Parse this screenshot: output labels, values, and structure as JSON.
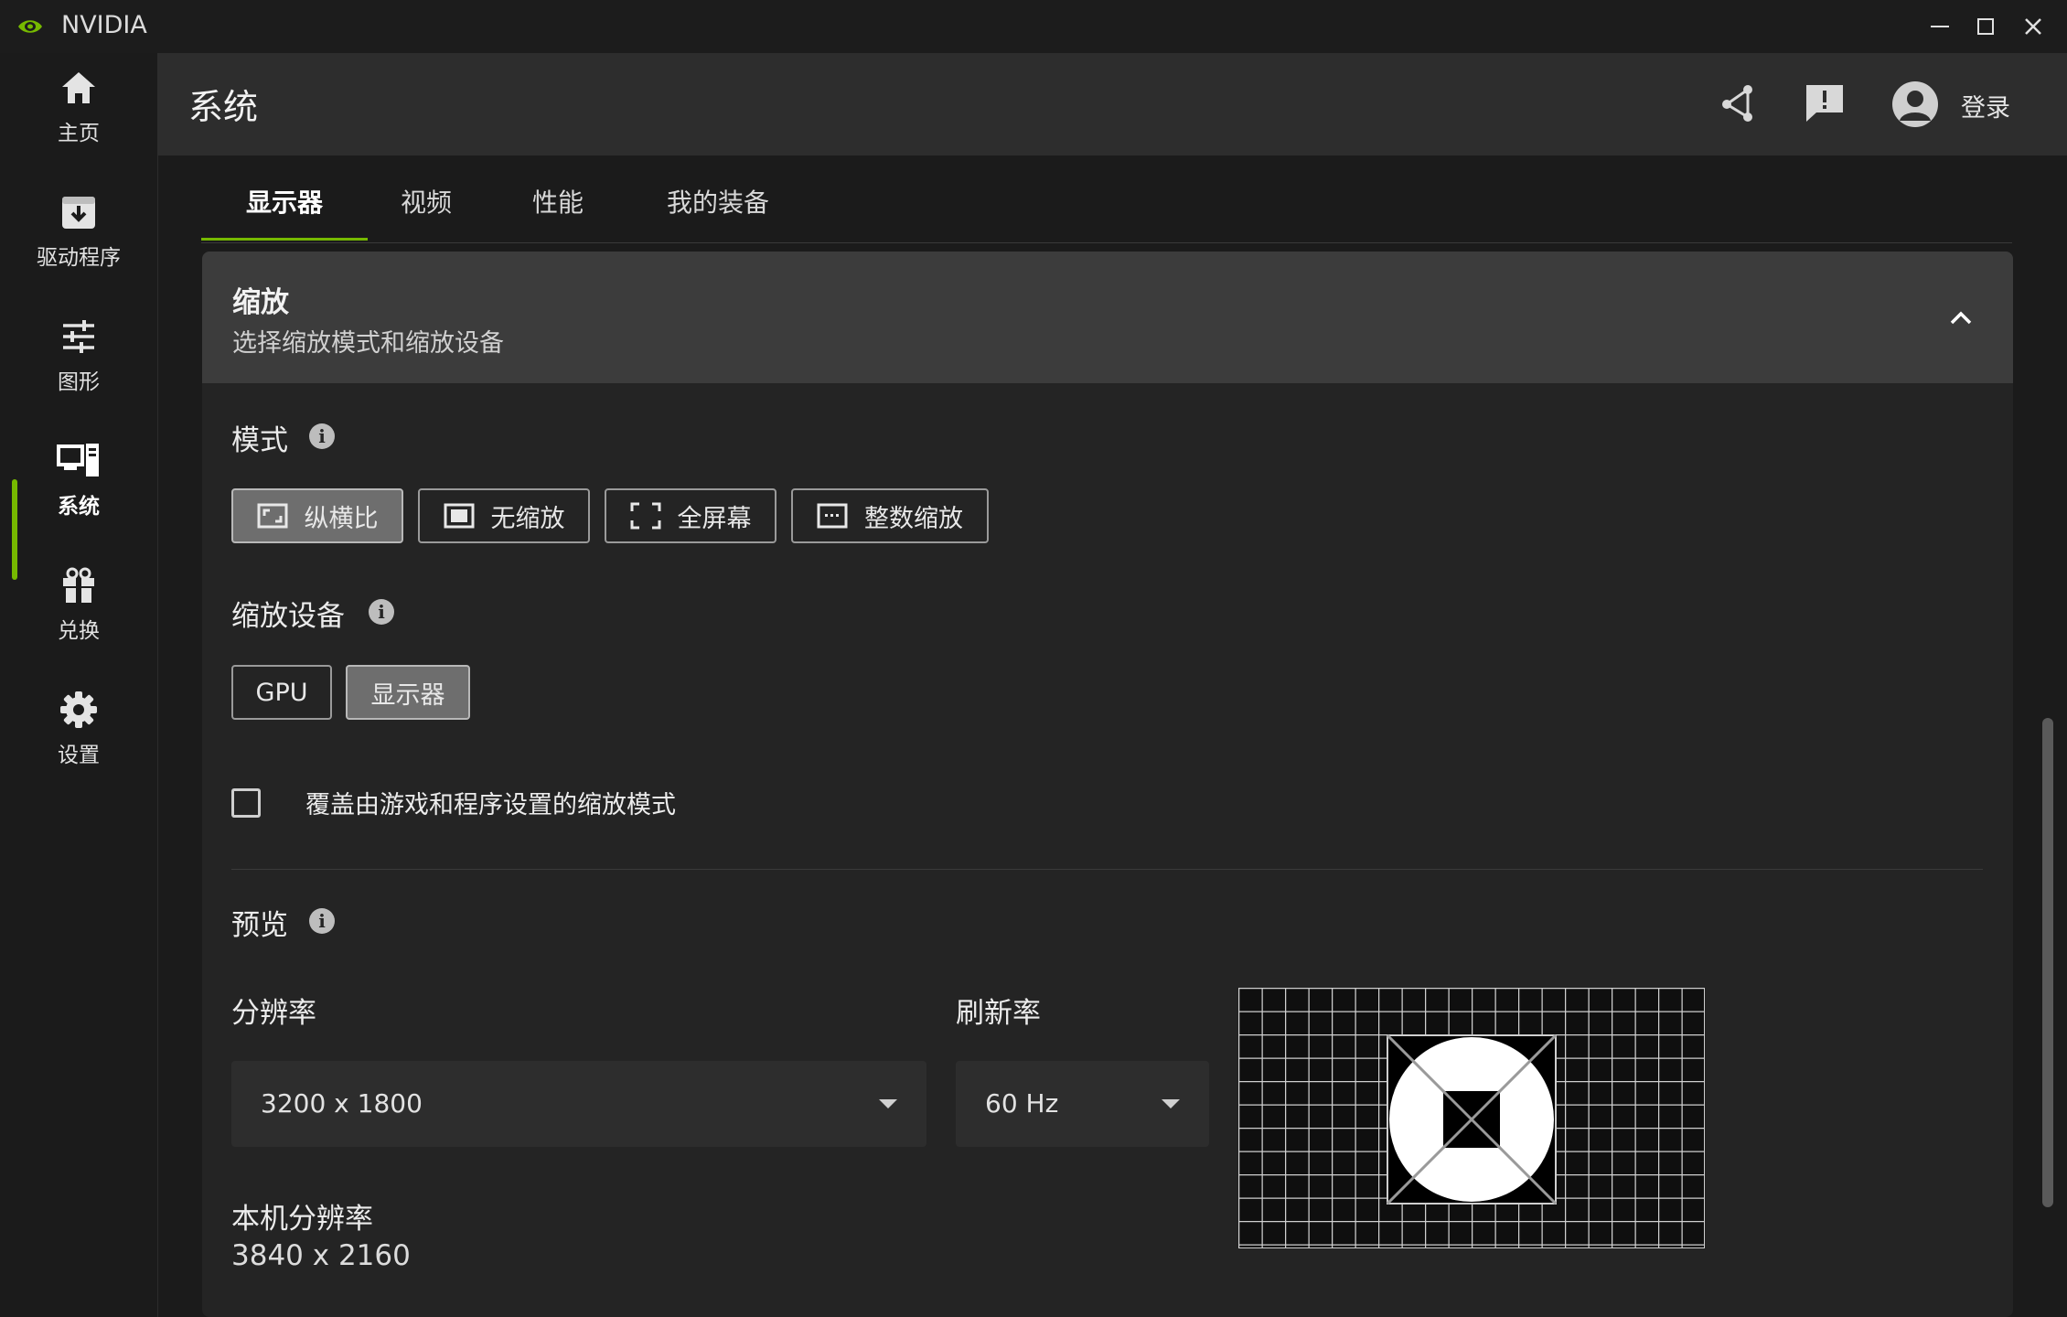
{
  "window": {
    "app_name": "NVIDIA"
  },
  "sidebar": {
    "items": [
      {
        "label": "主页",
        "icon": "home-icon"
      },
      {
        "label": "驱动程序",
        "icon": "driver-download-icon"
      },
      {
        "label": "图形",
        "icon": "sliders-icon"
      },
      {
        "label": "系统",
        "icon": "system-monitor-icon",
        "active": true
      },
      {
        "label": "兑换",
        "icon": "gift-icon"
      },
      {
        "label": "设置",
        "icon": "gear-icon"
      }
    ]
  },
  "header": {
    "title": "系统",
    "login_label": "登录"
  },
  "tabs": [
    {
      "label": "显示器",
      "active": true
    },
    {
      "label": "视频"
    },
    {
      "label": "性能"
    },
    {
      "label": "我的装备"
    }
  ],
  "scaling": {
    "title": "缩放",
    "subtitle": "选择缩放模式和缩放设备",
    "mode_label": "模式",
    "modes": [
      {
        "label": "纵横比",
        "selected": true
      },
      {
        "label": "无缩放"
      },
      {
        "label": "全屏幕"
      },
      {
        "label": "整数缩放"
      }
    ],
    "device_label": "缩放设备",
    "devices": [
      {
        "label": "GPU"
      },
      {
        "label": "显示器",
        "selected": true
      }
    ],
    "override_label": "覆盖由游戏和程序设置的缩放模式",
    "override_checked": false,
    "preview_label": "预览",
    "resolution_label": "分辨率",
    "resolution_value": "3200 x 1800",
    "refresh_label": "刷新率",
    "refresh_value": "60 Hz",
    "native_label": "本机分辨率",
    "native_value": "3840 x 2160"
  },
  "colors": {
    "accent": "#76b900",
    "background": "#1b1b1b",
    "card": "#242424",
    "card_header": "#3c3c3c"
  }
}
